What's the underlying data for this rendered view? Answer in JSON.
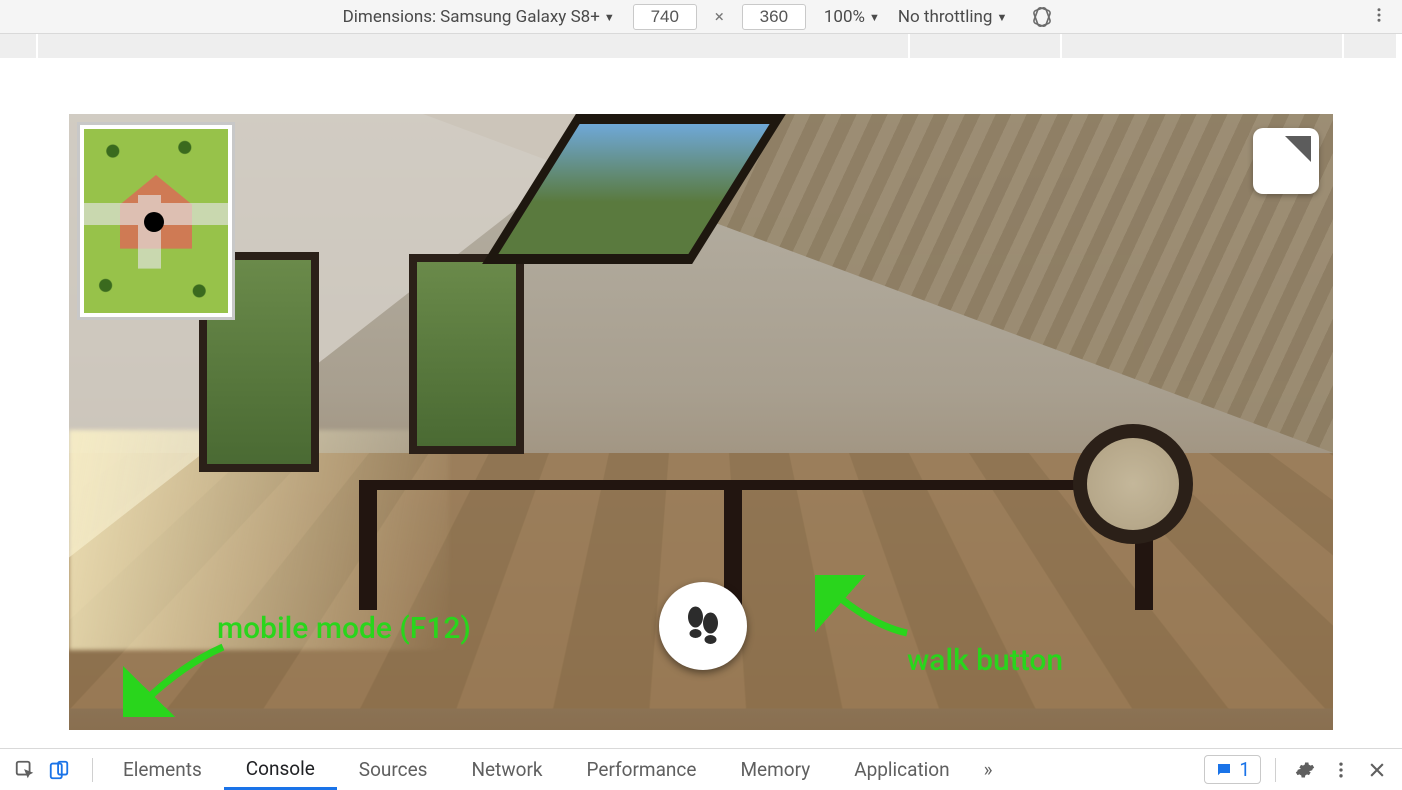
{
  "toolbar": {
    "dimensions_label": "Dimensions:",
    "device": "Samsung Galaxy S8+",
    "width": "740",
    "height": "360",
    "size_separator": "×",
    "zoom": "100%",
    "throttling": "No throttling"
  },
  "annotations": {
    "mobile": "mobile mode (F12)",
    "walk": "walk button"
  },
  "devtools": {
    "tabs": [
      "Elements",
      "Console",
      "Sources",
      "Network",
      "Performance",
      "Memory",
      "Application"
    ],
    "active_tab": "Console",
    "more": "»",
    "issues_count": "1"
  }
}
